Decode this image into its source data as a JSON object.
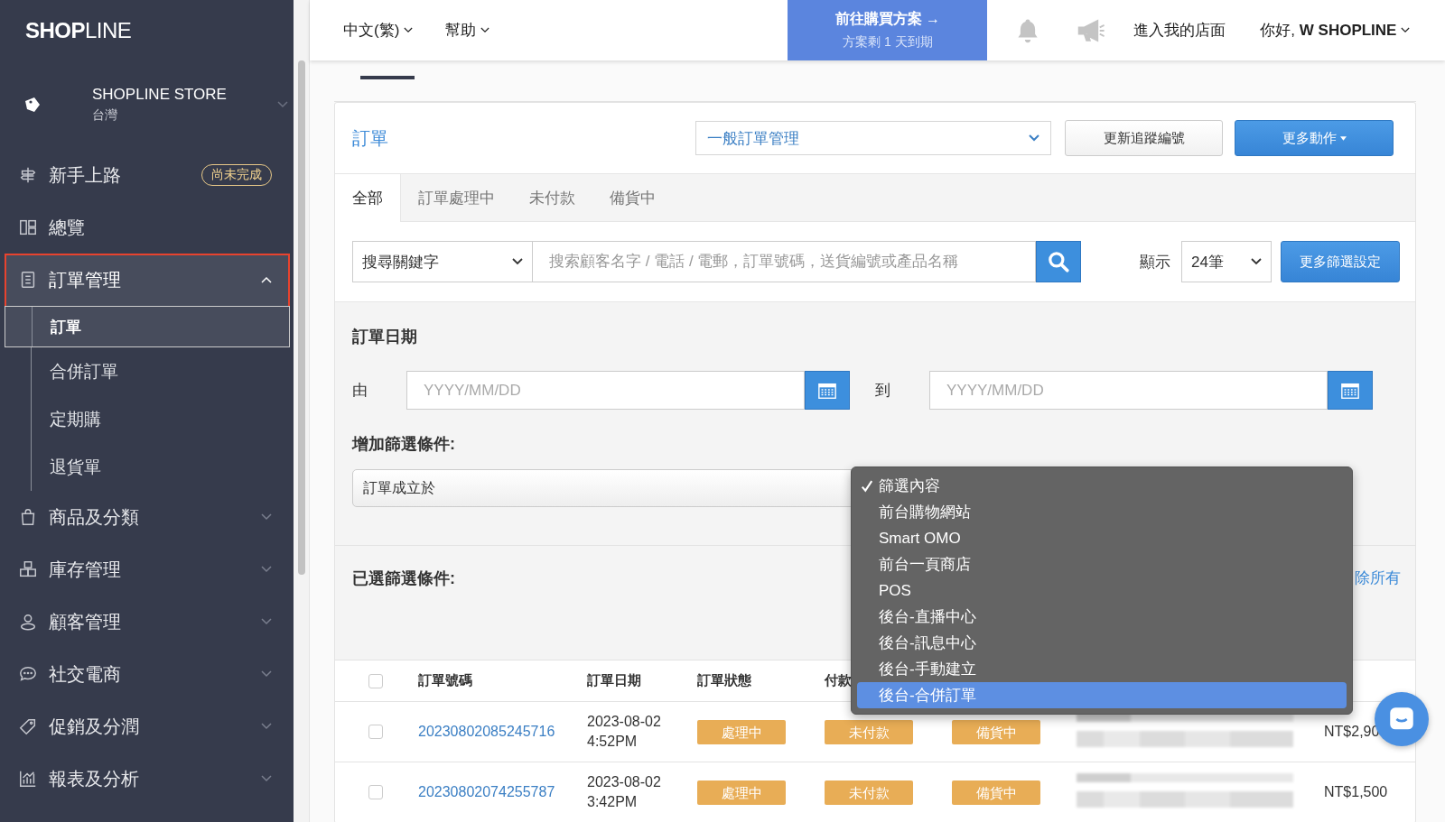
{
  "sidebar": {
    "logo": "**SHOP**LINE",
    "store": {
      "name": "SHOPLINE STORE",
      "region": "台灣"
    },
    "items": [
      {
        "label": "新手上路",
        "kind": "link",
        "badge": "尚未完成"
      },
      {
        "label": "總覽",
        "kind": "link"
      },
      {
        "label": "訂單管理",
        "kind": "group",
        "expanded": true,
        "highlighted": true,
        "children": [
          {
            "label": "訂單",
            "selected": true
          },
          {
            "label": "合併訂單",
            "selected": false
          },
          {
            "label": "定期購",
            "selected": false
          },
          {
            "label": "退貨單",
            "selected": false
          }
        ]
      },
      {
        "label": "商品及分類",
        "kind": "group",
        "expanded": false,
        "highlighted": false
      },
      {
        "label": "庫存管理",
        "kind": "group",
        "expanded": false,
        "highlighted": false
      },
      {
        "label": "顧客管理",
        "kind": "group",
        "expanded": false,
        "highlighted": false
      },
      {
        "label": "社交電商",
        "kind": "group",
        "expanded": false,
        "highlighted": false
      },
      {
        "label": "促銷及分潤",
        "kind": "group",
        "expanded": false,
        "highlighted": false
      },
      {
        "label": "報表及分析",
        "kind": "group",
        "expanded": false,
        "highlighted": false
      }
    ]
  },
  "top_bar": {
    "language": "中文(繁)",
    "help": "幫助",
    "upgrade": {
      "title": "前往購買方案 →",
      "subtitle": "方案剩 1 天到期"
    },
    "storefront": "進入我的店面",
    "greeting": "你好, **W SHOPLINE**"
  },
  "orders": {
    "title": "訂單",
    "view_select": "一般訂單管理",
    "buttons": [
      {
        "label": "更新追蹤編號",
        "kind": "default"
      },
      {
        "label": "更多動作",
        "kind": "primary"
      }
    ],
    "tabs": [
      {
        "label": "全部",
        "selected": true
      },
      {
        "label": "訂單處理中",
        "selected": false
      },
      {
        "label": "未付款",
        "selected": false
      },
      {
        "label": "備貨中",
        "selected": false
      }
    ],
    "search": {
      "field_select": "搜尋關鍵字",
      "placeholder": "搜索顧客名字 / 電話 / 電郵，訂單號碼，送貨編號或產品名稱",
      "page_size_label": "顯示",
      "page_size": "24筆",
      "more_filters": "更多篩選設定"
    },
    "date_filter": {
      "title": "訂單日期",
      "from_label": "由",
      "from_placeholder": "YYYY/MM/DD",
      "to_label": "到",
      "to_placeholder": "YYYY/MM/DD"
    },
    "add_filter": {
      "title": "增加篩選條件:",
      "field": "訂單成立於",
      "dropdown": [
        {
          "label": "篩選內容",
          "checked": true,
          "selected": false
        },
        {
          "label": "前台購物網站",
          "checked": false,
          "selected": false
        },
        {
          "label": "Smart OMO",
          "checked": false,
          "selected": false
        },
        {
          "label": "前台一頁商店",
          "checked": false,
          "selected": false
        },
        {
          "label": "POS",
          "checked": false,
          "selected": false
        },
        {
          "label": "後台-直播中心",
          "checked": false,
          "selected": false
        },
        {
          "label": "後台-訊息中心",
          "checked": false,
          "selected": false
        },
        {
          "label": "後台-手動建立",
          "checked": false,
          "selected": false
        },
        {
          "label": "後台-合併訂單",
          "checked": false,
          "selected": true
        }
      ]
    },
    "selected_filters": {
      "title": "已選篩選條件:",
      "clear_link": "除所有"
    },
    "table": {
      "select_all_checked": false,
      "columns": [
        "訂單號碼",
        "訂單日期",
        "訂單狀態",
        "付款"
      ],
      "rows": [
        {
          "checked": false,
          "order_no": "20230802085245716",
          "date": "2023-08-02",
          "time": "4:52PM",
          "status": "處理中",
          "payment": "未付款",
          "delivery": "備貨中",
          "amount": "NT$2,90"
        },
        {
          "checked": false,
          "order_no": "20230802074255787",
          "date": "2023-08-02",
          "time": "3:42PM",
          "status": "處理中",
          "payment": "未付款",
          "delivery": "備貨中",
          "amount": "NT$1,500"
        }
      ]
    }
  }
}
